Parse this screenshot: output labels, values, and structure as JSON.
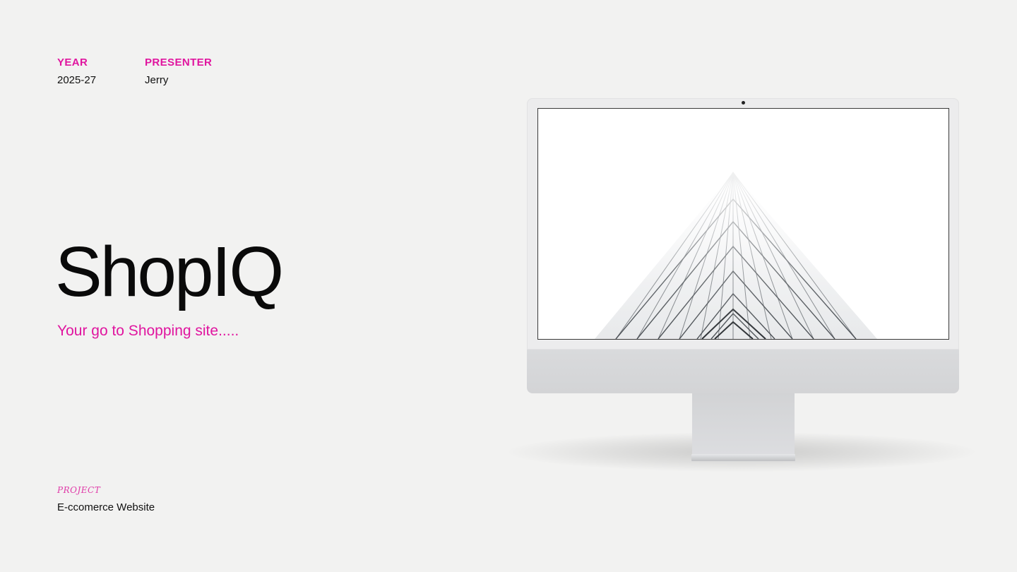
{
  "meta": {
    "year_label": "YEAR",
    "year_value": "2025-27",
    "presenter_label": "PRESENTER",
    "presenter_value": "Jerry"
  },
  "hero": {
    "title": "ShopIQ",
    "tagline": "Your go to Shopping site....."
  },
  "project": {
    "label": "PROJECT",
    "value": "E-ccomerce Website"
  },
  "colors": {
    "accent": "#e0159f",
    "background": "#f2f2f1",
    "text": "#111111"
  },
  "illustration": {
    "device": "desktop-monitor",
    "screen_image": "skyscraper-looking-up"
  }
}
